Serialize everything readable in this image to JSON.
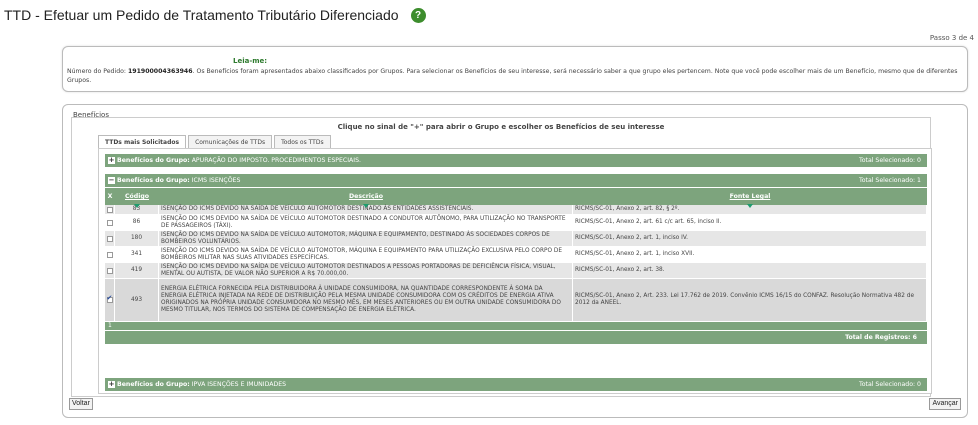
{
  "page": {
    "title": "TTD - Efetuar um Pedido de Tratamento Tributário Diferenciado",
    "help_icon": "?",
    "step": "Passo 3 de 4"
  },
  "leiame": {
    "title": "Leia-me:",
    "order_label": "Número do Pedido:",
    "order_number": "191900004363946",
    "text": ". Os Benefícios foram apresentados abaixo classificados por Grupos. Para selecionar os Benefícios de seu interesse, será necessário saber a que grupo eles pertencem. Note que você pode escolher mais de um Benefício, mesmo que de diferentes Grupos."
  },
  "beneficios": {
    "legend": "Benefícios",
    "instruction": "Clique no sinal de \"+\" para abrir o Grupo e escolher os Benefícios de seu interesse",
    "tabs": [
      "TTDs mais Solicitados",
      "Comunicações de TTDs",
      "Todos os TTDs"
    ],
    "groups": [
      {
        "prefix": "Benefícios do Grupo:",
        "name": "APURAÇÃO DO IMPOSTO. PROCEDIMENTOS ESPECIAIS.",
        "total": "Total Selecionado: 0",
        "toggle": "+"
      },
      {
        "prefix": "Benefícios do Grupo:",
        "name": "ICMS ISENÇÕES",
        "total": "Total Selecionado: 1",
        "toggle": "−"
      },
      {
        "prefix": "Benefícios do Grupo:",
        "name": "IPVA ISENÇÕES E IMUNIDADES",
        "total": "Total Selecionado: 0",
        "toggle": "+"
      }
    ],
    "columns": {
      "x": "X",
      "codigo": "Código",
      "descricao": "Descrição",
      "fonte": "Fonte Legal"
    },
    "rows": [
      {
        "codigo": "83",
        "descricao": "ISENÇÃO DO ICMS DEVIDO NA SAÍDA DE VEÍCULO AUTOMOTOR DESTINADO ÀS ENTIDADES ASSISTENCIAIS.",
        "fonte": "RICMS/SC-01, Anexo 2, art. 82, § 2º."
      },
      {
        "codigo": "86",
        "descricao": "ISENÇÃO DO ICMS DEVIDO NA SAÍDA DE VEÍCULO AUTOMOTOR DESTINADO A CONDUTOR AUTÔNOMO, PARA UTILIZAÇÃO NO TRANSPORTE DE PASSAGEIROS (TÁXI).",
        "fonte": "RICMS/SC-01, Anexo 2, art. 61 c/c art. 65, inciso II."
      },
      {
        "codigo": "180",
        "descricao": "ISENÇÃO DO ICMS DEVIDO NA SAÍDA DE VEÍCULO AUTOMOTOR, MÁQUINA E EQUIPAMENTO, DESTINADO ÀS SOCIEDADES CORPOS DE BOMBEIROS VOLUNTÁRIOS.",
        "fonte": "RICMS/SC-01, Anexo 2, art. 1, inciso IV."
      },
      {
        "codigo": "341",
        "descricao": "ISENÇÃO DO ICMS DEVIDO NA SAÍDA DE VEÍCULO AUTOMOTOR, MÁQUINA E EQUIPAMENTO PARA UTILIZAÇÃO EXCLUSIVA PELO CORPO DE BOMBEIROS MILITAR NAS SUAS ATIVIDADES ESPECÍFICAS.",
        "fonte": "RICMS/SC-01, Anexo 2, art. 1, inciso XVII."
      },
      {
        "codigo": "419",
        "descricao": "ISENÇÃO DO ICMS DEVIDO NA SAÍDA DE VEÍCULO AUTOMOTOR DESTINADOS A PESSOAS PORTADORAS DE DEFICIÊNCIA FÍSICA, VISUAL, MENTAL OU AUTISTA, DE VALOR NÃO SUPERIOR A R$ 70.000,00.",
        "fonte": "RICMS/SC-01, Anexo 2, art. 38."
      },
      {
        "codigo": "493",
        "descricao": "ENERGIA ELÉTRICA FORNECIDA PELA DISTRIBUIDORA À UNIDADE CONSUMIDORA, NA QUANTIDADE CORRESPONDENTE À SOMA DA ENERGIA ELÉTRICA INJETADA NA REDE DE DISTRIBUIÇÃO PELA MESMA UNIDADE CONSUMIDORA COM OS CRÉDITOS DE ENERGIA ATIVA ORIGINADOS NA PRÓPRIA UNIDADE CONSUMIDORA NO MESMO MÊS, EM MESES ANTERIORES OU EM OUTRA UNIDADE CONSUMIDORA DO MESMO TITULAR, NOS TERMOS DO SISTEMA DE COMPENSAÇÃO DE ENERGIA ELÉTRICA.",
        "fonte": "RICMS/SC-01, Anexo 2, Art. 233. Lei 17.762 de 2019. Convênio ICMS 16/15 do CONFAZ. Resolução Normativa 482 de 2012 da ANEEL."
      }
    ],
    "pager": "1",
    "total_registros": "Total de Registros: 6"
  },
  "buttons": {
    "voltar": "Voltar",
    "avancar": "Avançar"
  },
  "colors": {
    "grid_green": "#7da47d",
    "title_green": "#2d7a2d",
    "help_green": "#3d8d2d"
  }
}
